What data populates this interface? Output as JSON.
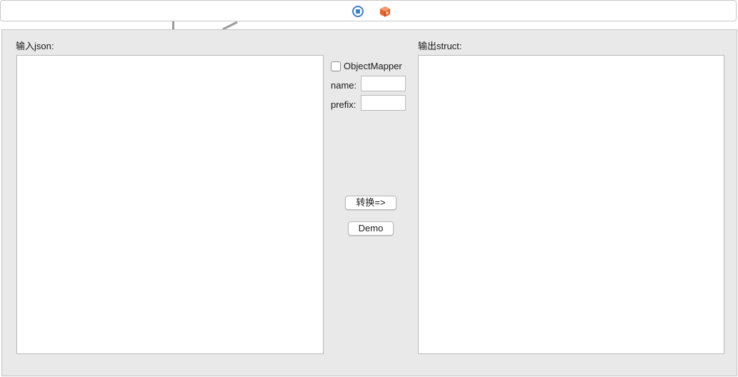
{
  "toolbar": {
    "icons": [
      "stop-icon",
      "package-icon"
    ],
    "colors": {
      "stop": "#3b7fd1",
      "package": "#e8622c"
    }
  },
  "input_panel": {
    "label": "输入json:",
    "value": ""
  },
  "options": {
    "objectmapper_label": "ObjectMapper",
    "objectmapper_checked": false,
    "name_label": "name:",
    "name_value": "",
    "prefix_label": "prefix:",
    "prefix_value": ""
  },
  "actions": {
    "convert_label": "转换=>",
    "demo_label": "Demo"
  },
  "output_panel": {
    "label": "输出struct:",
    "value": ""
  }
}
